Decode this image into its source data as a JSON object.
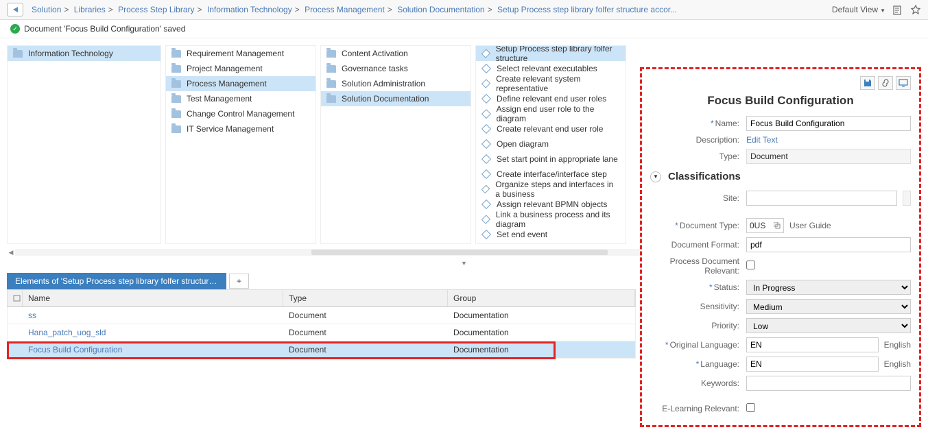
{
  "topbar": {
    "breadcrumbs": [
      "Solution",
      "Libraries",
      "Process Step Library",
      "Information Technology",
      "Process Management",
      "Solution Documentation",
      "Setup  Process step library folfer structure accor..."
    ],
    "default_view": "Default View"
  },
  "status": {
    "message": "Document 'Focus Build Configuration' saved"
  },
  "col1": {
    "items": [
      "Information Technology"
    ],
    "selected": 0
  },
  "col2": {
    "items": [
      "Requirement Management",
      "Project Management",
      "Process Management",
      "Test Management",
      "Change Control Management",
      "IT Service Management"
    ],
    "selected": 2
  },
  "col3": {
    "items": [
      "Content Activation",
      "Governance tasks",
      "Solution Administration",
      "Solution Documentation"
    ],
    "selected": 3
  },
  "col4": {
    "items": [
      "Setup  Process step library folfer structure",
      "Select relevant executables",
      "Create relevant system representative",
      "Define relevant end user roles",
      "Assign end user role to the diagram",
      "Create relevant end user role",
      "Open diagram",
      "Set start point in appropriate lane",
      "Create interface/interface step",
      "Organize steps and interfaces in a business",
      "Assign relevant BPMN objects",
      "Link a business process and its diagram",
      "Set end event"
    ],
    "selected": 0
  },
  "elements": {
    "tab_title": "Elements of 'Setup Process step library folfer structure accord...",
    "add_label": "+",
    "headers": {
      "name": "Name",
      "type": "Type",
      "group": "Group"
    },
    "rows": [
      {
        "name": "ss",
        "type": "Document",
        "group": "Documentation"
      },
      {
        "name": "Hana_patch_uog_sld",
        "type": "Document",
        "group": "Documentation"
      },
      {
        "name": "Focus Build Configuration",
        "type": "Document",
        "group": "Documentation"
      }
    ],
    "selected": 2
  },
  "details": {
    "title": "Focus Build Configuration",
    "name_label": "Name:",
    "name_value": "Focus Build Configuration",
    "description_label": "Description:",
    "description_link": "Edit Text",
    "type_label": "Type:",
    "type_value": "Document",
    "classifications_header": "Classifications",
    "site_label": "Site:",
    "site_value": "",
    "doctype_label": "Document Type:",
    "doctype_code": "0US",
    "doctype_text": "User Guide",
    "docformat_label": "Document Format:",
    "docformat_value": "pdf",
    "procdoc_label": "Process Document Relevant:",
    "status_label": "Status:",
    "status_value": "In Progress",
    "sensitivity_label": "Sensitivity:",
    "sensitivity_value": "Medium",
    "priority_label": "Priority:",
    "priority_value": "Low",
    "origlang_label": "Original Language:",
    "origlang_code": "EN",
    "origlang_text": "English",
    "lang_label": "Language:",
    "lang_code": "EN",
    "lang_text": "English",
    "keywords_label": "Keywords:",
    "keywords_value": "",
    "elearning_label": "E-Learning Relevant:"
  }
}
